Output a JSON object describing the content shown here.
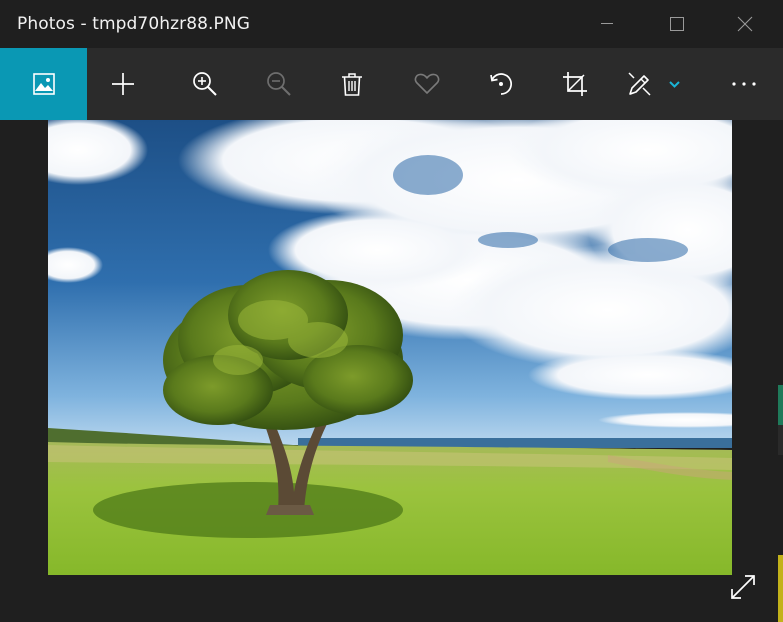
{
  "window": {
    "title": "Photos - tmpd70hzr88.PNG"
  },
  "toolbar": {
    "buttons": [
      {
        "name": "see-all-photos",
        "icon": "picture-icon",
        "active": true
      },
      {
        "name": "add-to-album",
        "icon": "plus-icon"
      },
      {
        "name": "zoom-in",
        "icon": "zoom-in-icon"
      },
      {
        "name": "zoom-out",
        "icon": "zoom-out-icon",
        "disabled": true
      },
      {
        "name": "delete",
        "icon": "trash-icon"
      },
      {
        "name": "favorite",
        "icon": "heart-icon",
        "disabled": true
      },
      {
        "name": "rotate",
        "icon": "rotate-icon"
      },
      {
        "name": "crop",
        "icon": "crop-icon"
      },
      {
        "name": "edit-and-create",
        "icon": "edit-pen-icon",
        "has_dropdown": true
      },
      {
        "name": "see-more",
        "icon": "more-icon"
      }
    ]
  },
  "colors": {
    "accent": "#0a98b4",
    "titlebar": "#1f1f1f",
    "toolbar": "#2b2b2b",
    "dropdown_chevron": "#1ab4d6"
  }
}
